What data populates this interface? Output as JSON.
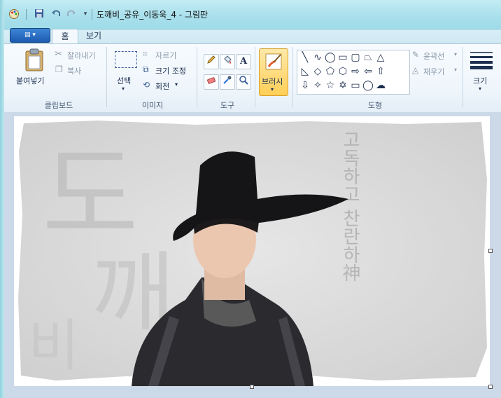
{
  "window": {
    "title": "도깨비_공유_이동욱_4 - 그림판"
  },
  "quick_access": {
    "save_icon": "save-icon",
    "undo_icon": "undo-icon",
    "redo_icon": "redo-icon"
  },
  "tabs": [
    {
      "label": "홈"
    },
    {
      "label": "보기"
    }
  ],
  "ribbon": {
    "clipboard": {
      "paste": "붙여넣기",
      "cut": "잘라내기",
      "copy": "복사",
      "group": "클립보드"
    },
    "image": {
      "select": "선택",
      "crop": "자르기",
      "resize": "크기 조정",
      "rotate": "회전",
      "group": "이미지"
    },
    "tools": {
      "text_tool": "A",
      "group": "도구"
    },
    "brushes": {
      "label": "브러시"
    },
    "shapes": {
      "outline": "윤곽선",
      "fill": "채우기",
      "group": "도형"
    },
    "size": {
      "label": "크기"
    }
  },
  "artwork": {
    "calligraphy": [
      "도",
      "깨",
      "비"
    ],
    "vertical_text": "고독하고 찬란하神"
  },
  "colors": {
    "title_bar": "#a9e0ec",
    "ribbon_bg": "#eef5fb",
    "highlight": "#ffcf58",
    "canvas_bg": "#cbd9e8"
  }
}
